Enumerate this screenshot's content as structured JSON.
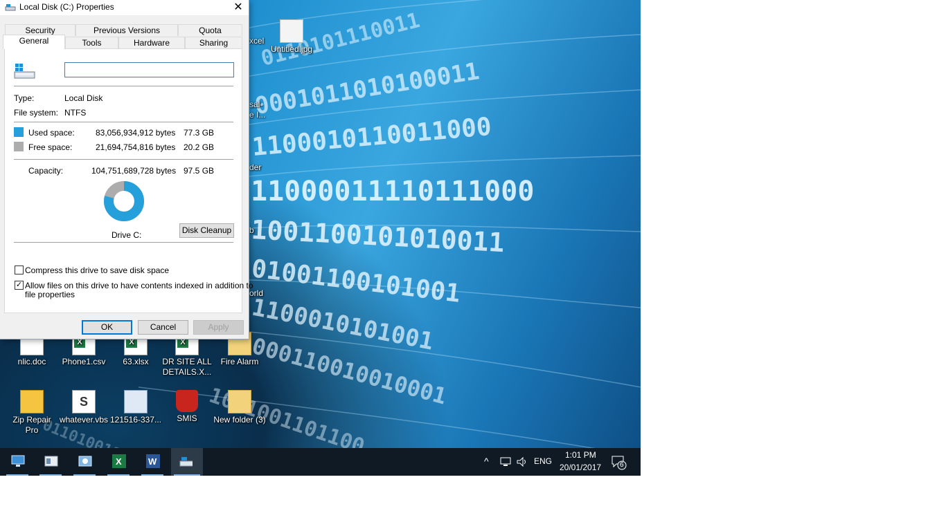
{
  "window": {
    "title": "Local Disk (C:) Properties",
    "close_glyph": "✕"
  },
  "tabs": {
    "row1": [
      "Security",
      "Previous Versions",
      "Quota"
    ],
    "row2": [
      "General",
      "Tools",
      "Hardware",
      "Sharing"
    ],
    "active": "General"
  },
  "general": {
    "name_value": "",
    "type_label": "Type:",
    "type_value": "Local Disk",
    "fs_label": "File system:",
    "fs_value": "NTFS",
    "used_label": "Used space:",
    "used_bytes": "83,056,934,912 bytes",
    "used_gb": "77.3 GB",
    "free_label": "Free space:",
    "free_bytes": "21,694,754,816 bytes",
    "free_gb": "20.2 GB",
    "capacity_label": "Capacity:",
    "capacity_bytes": "104,751,689,728 bytes",
    "capacity_gb": "97.5 GB",
    "drive_label": "Drive C:",
    "used_fraction": 0.793,
    "used_color": "#26a0da",
    "free_color": "#adadad",
    "disk_cleanup": "Disk Cleanup",
    "compress_label": "Compress this drive to save disk space",
    "compress_checked": false,
    "index_label_line1": "Allow files on this drive to have contents indexed in addition to",
    "index_label_line2": "file properties",
    "index_checked": true,
    "check_glyph": "✓"
  },
  "buttons": {
    "ok": "OK",
    "cancel": "Cancel",
    "apply": "Apply"
  },
  "desktop": {
    "partial_labels": [
      "xcel",
      "sal-",
      "e I...",
      "der",
      "b",
      "orld"
    ],
    "top_icon": "Untitled.jpg",
    "row1": [
      "nlic.doc",
      "Phone1.csv",
      "63.xlsx",
      "DR SITE ALL DETAILS.X...",
      "Fire Alarm"
    ],
    "row2": [
      "Zip Repair Pro",
      "whatever.vbs",
      "121516-337...",
      "SMIS",
      "New folder (3)"
    ],
    "vbs_glyph": "S"
  },
  "taskbar": {
    "apps": [
      "this-pc",
      "file-explorer",
      "network-app",
      "excel",
      "word",
      "disk-properties"
    ],
    "tray_chevron": "^",
    "lang": "ENG",
    "time": "1:01 PM",
    "date": "20/01/2017",
    "notifications": "6"
  }
}
